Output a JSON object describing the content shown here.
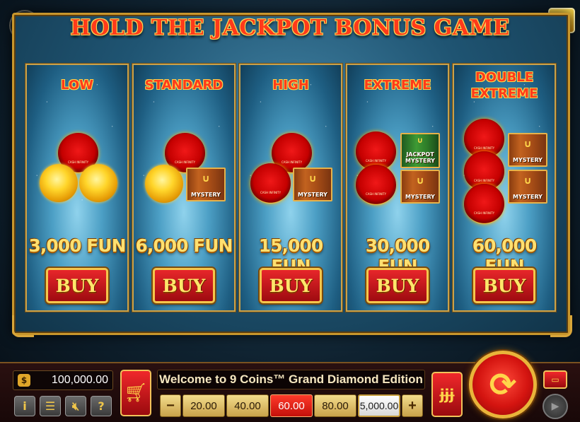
{
  "title": "HOLD THE JACKPOT BONUS GAME",
  "close_glyph": "✕",
  "coin_label": "CASH INFINITY",
  "options": [
    {
      "tier": "LOW",
      "price": "3,000 FUN",
      "buy": "BUY"
    },
    {
      "tier": "STANDARD",
      "price": "6,000 FUN",
      "buy": "BUY",
      "box_label": "MYSTERY"
    },
    {
      "tier": "HIGH",
      "price": "15,000 FUN",
      "buy": "BUY",
      "box_label": "MYSTERY"
    },
    {
      "tier": "EXTREME",
      "price": "30,000 FUN",
      "buy": "BUY",
      "jackpot_box_label": "JACKPOT MYSTERY",
      "box_label": "MYSTERY"
    },
    {
      "tier_line1": "DOUBLE",
      "tier_line2": "EXTREME",
      "price": "60,000 FUN",
      "buy": "BUY",
      "box_label": "MYSTERY"
    }
  ],
  "bottom_bar": {
    "balance": "100,000.00",
    "welcome": "Welcome to 9 Coins™ Grand Diamond Edition",
    "bets": [
      "20.00",
      "40.00",
      "60.00",
      "80.00",
      "5,000.00"
    ],
    "selected_bet": "60.00",
    "minus": "−",
    "plus": "+",
    "help_glyph": "?",
    "info_glyph": "i"
  },
  "colors": {
    "title_red": "#ff3a1a",
    "price_gold": "#ffe070",
    "frame_gold": "#c8962c",
    "buy_red": "#d41410"
  },
  "icons": [
    "exit-icon",
    "close-icon",
    "money-bag-icon",
    "info-icon",
    "menu-icon",
    "sound-off-icon",
    "help-icon",
    "cart-icon",
    "fire-turbo-icon",
    "spin-icon",
    "autoplay-icon",
    "play-icon"
  ]
}
